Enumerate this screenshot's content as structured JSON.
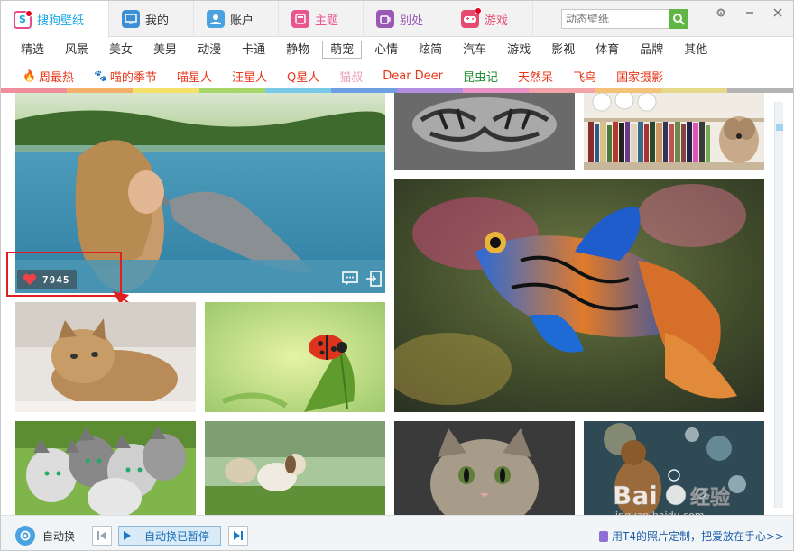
{
  "app": {
    "tabs": [
      {
        "label": "搜狗壁纸",
        "icon": "sogou-logo-icon",
        "color": "#1aa6e4",
        "active": true
      },
      {
        "label": "我的",
        "icon": "monitor-icon",
        "color": "#3d8fd6"
      },
      {
        "label": "账户",
        "icon": "user-icon",
        "color": "#4aa3df"
      },
      {
        "label": "主题",
        "icon": "theme-icon",
        "color": "#e9558f"
      },
      {
        "label": "别处",
        "icon": "cup-icon",
        "color": "#9b59b6"
      },
      {
        "label": "游戏",
        "icon": "gamepad-icon",
        "color": "#e84a6f"
      }
    ],
    "search": {
      "placeholder": "动态壁纸"
    }
  },
  "categories": [
    "精选",
    "风景",
    "美女",
    "美男",
    "动漫",
    "卡通",
    "静物",
    "萌宠",
    "心情",
    "炫简",
    "汽车",
    "游戏",
    "影视",
    "体育",
    "品牌",
    "其他"
  ],
  "active_category": "萌宠",
  "subcategories": [
    {
      "label": "周最热",
      "color": "#e8361a",
      "icon": "fire-icon"
    },
    {
      "label": "喵的季节",
      "color": "#e8361a",
      "icon": "paw-icon"
    },
    {
      "label": "喵星人",
      "color": "#e8361a"
    },
    {
      "label": "汪星人",
      "color": "#e8361a"
    },
    {
      "label": "Q星人",
      "color": "#e8361a"
    },
    {
      "label": "猫叔",
      "color": "#e8a0b4"
    },
    {
      "label": "Dear Deer",
      "color": "#e8361a"
    },
    {
      "label": "昆虫记",
      "color": "#1f8e32"
    },
    {
      "label": "天然呆",
      "color": "#e8361a"
    },
    {
      "label": "飞鸟",
      "color": "#e8361a"
    },
    {
      "label": "国家摄影",
      "color": "#e8361a"
    }
  ],
  "stripe_colors": [
    "#f08f9b",
    "#f4b16b",
    "#f5e06a",
    "#a7d66b",
    "#79c9e8",
    "#6e9fe0",
    "#b38ee0",
    "#e892c7",
    "#f2a2a9",
    "#f5c27a",
    "#e6d88a",
    "#b3b3b3"
  ],
  "featured": {
    "likes": "7945"
  },
  "bottom": {
    "auto_label": "自动换",
    "status": "自动换已暂停",
    "promo": "用T4的照片定制，把爱放在手心>>"
  },
  "watermark": {
    "text": "Bai经验",
    "sub": "jingyan.baidu.com"
  }
}
